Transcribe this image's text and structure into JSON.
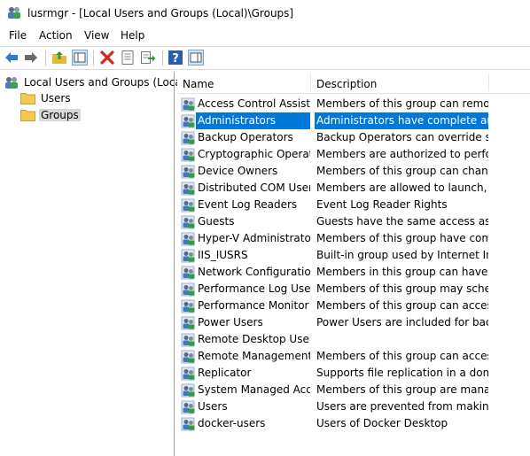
{
  "window": {
    "title": "lusrmgr - [Local Users and Groups (Local)\\Groups]"
  },
  "menu": [
    "File",
    "Action",
    "View",
    "Help"
  ],
  "toolbar": {
    "buttons": [
      "back-icon",
      "forward-icon",
      "up-folder-icon",
      "show-hide-tree-icon",
      "delete-icon",
      "properties-icon",
      "export-list-icon",
      "help-icon",
      "show-hide-action-pane-icon"
    ]
  },
  "tree": {
    "root": "Local Users and Groups (Local)",
    "children": [
      "Users",
      "Groups"
    ],
    "selected": "Groups"
  },
  "list": {
    "columns": [
      "Name",
      "Description"
    ],
    "selected_index": 1,
    "rows": [
      {
        "name": "Access Control Assist...",
        "description": "Members of this group can remot..."
      },
      {
        "name": "Administrators",
        "description": "Administrators have complete an..."
      },
      {
        "name": "Backup Operators",
        "description": "Backup Operators can override se..."
      },
      {
        "name": "Cryptographic Operat...",
        "description": "Members are authorized to perfor..."
      },
      {
        "name": "Device Owners",
        "description": "Members of this group can chang..."
      },
      {
        "name": "Distributed COM Users",
        "description": "Members are allowed to launch, a..."
      },
      {
        "name": "Event Log Readers",
        "description": "Event Log Reader Rights"
      },
      {
        "name": "Guests",
        "description": "Guests have the same access as m..."
      },
      {
        "name": "Hyper-V Administrators",
        "description": "Members of this group have com..."
      },
      {
        "name": "IIS_IUSRS",
        "description": "Built-in group used by Internet Inf..."
      },
      {
        "name": "Network Configuratio...",
        "description": "Members in this group can have s..."
      },
      {
        "name": "Performance Log Users",
        "description": "Members of this group may sche..."
      },
      {
        "name": "Performance Monitor ...",
        "description": "Members of this group can acces..."
      },
      {
        "name": "Power Users",
        "description": "Power Users are included for back..."
      },
      {
        "name": "Remote Desktop Users",
        "description": ""
      },
      {
        "name": "Remote Management...",
        "description": "Members of this group can acces..."
      },
      {
        "name": "Replicator",
        "description": "Supports file replication in a dom..."
      },
      {
        "name": "System Managed Acc...",
        "description": "Members of this group are mana..."
      },
      {
        "name": "Users",
        "description": "Users are prevented from making ..."
      },
      {
        "name": "docker-users",
        "description": "Users of Docker Desktop"
      }
    ]
  },
  "colors": {
    "selection": "#0078d7",
    "inactive_selection": "#d9d9d9",
    "folder": "#f4c94f"
  }
}
